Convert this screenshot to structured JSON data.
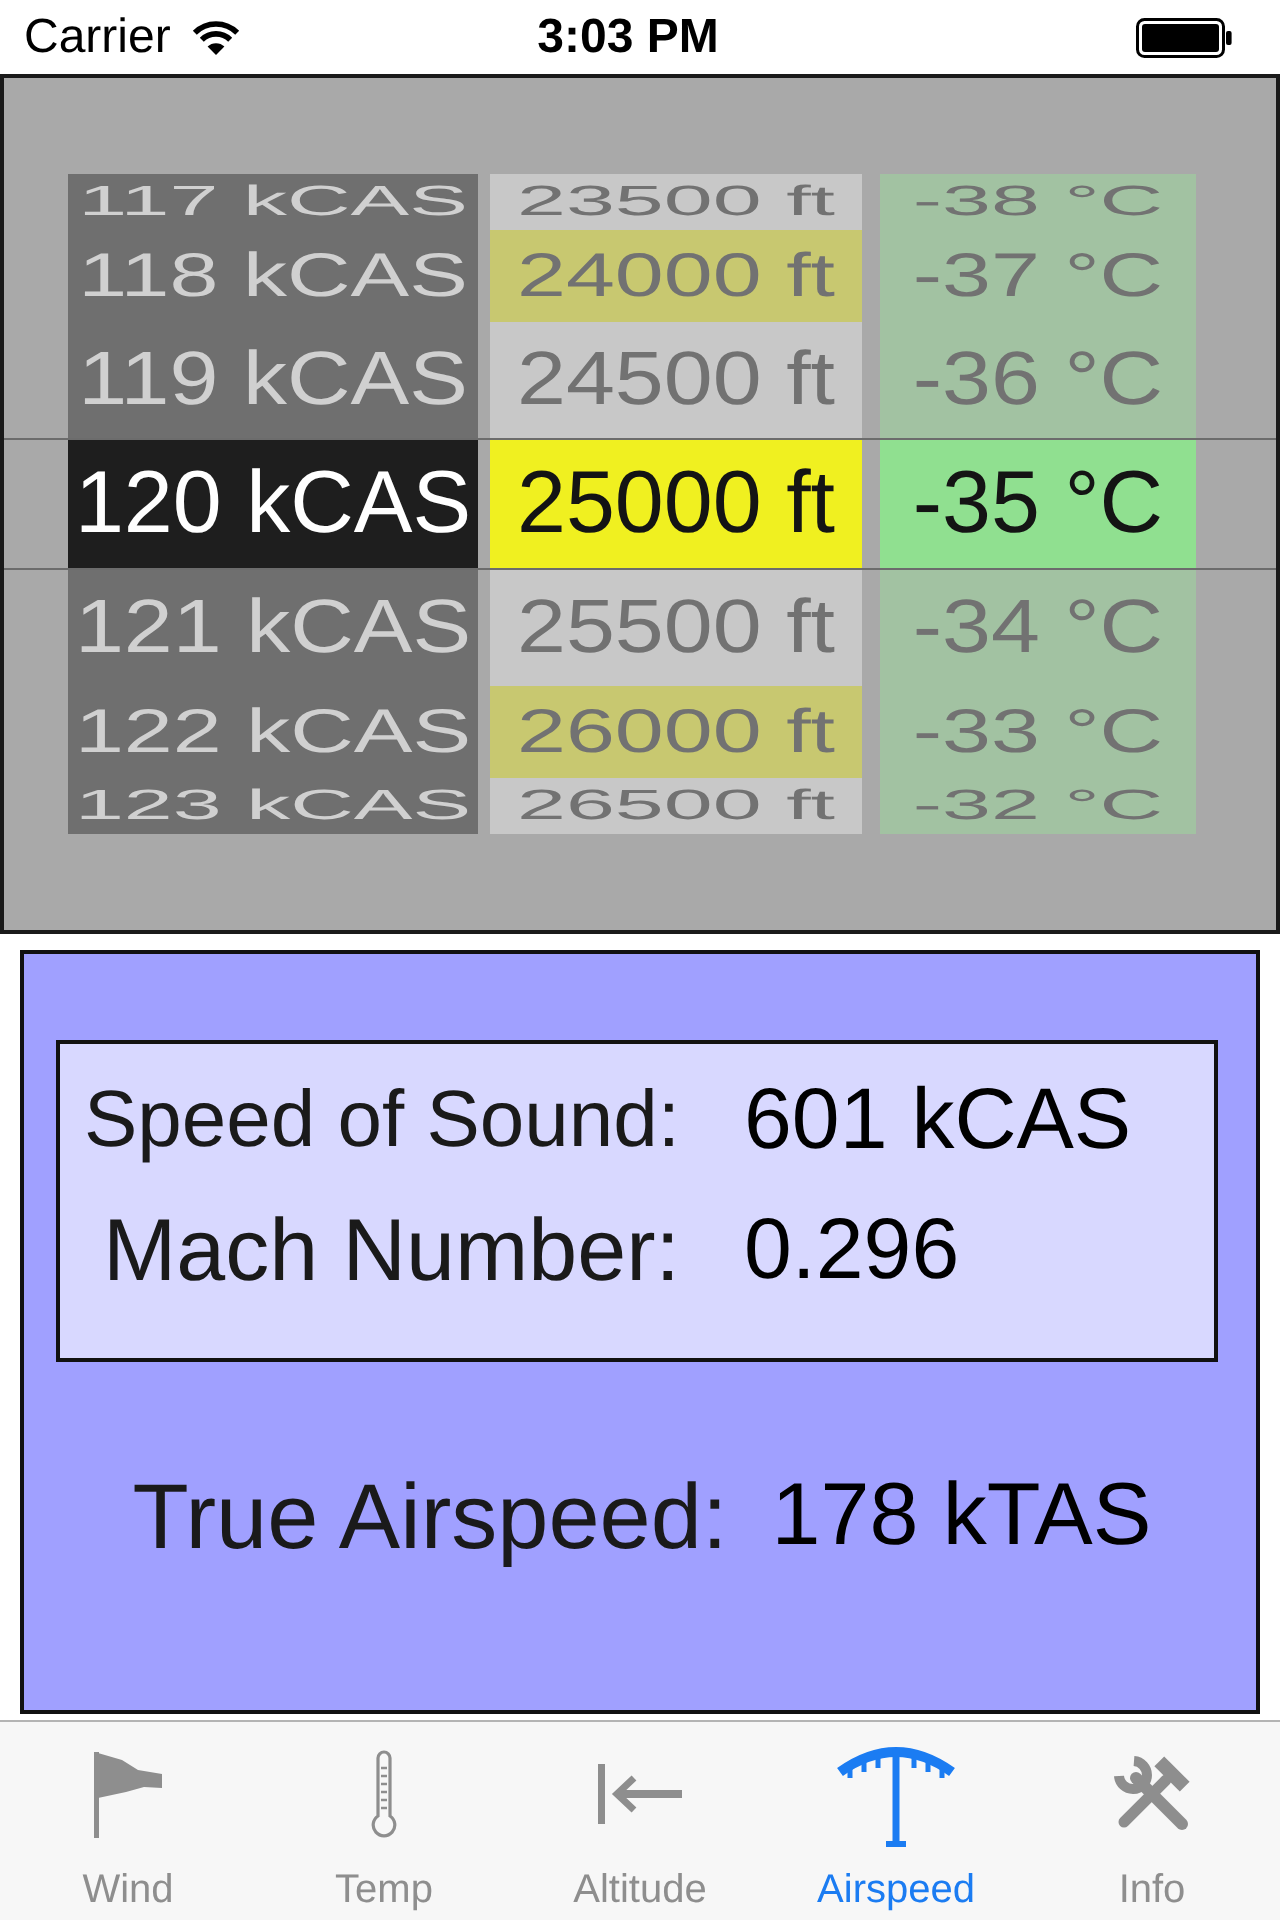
{
  "status_bar": {
    "carrier": "Carrier",
    "time": "3:03 PM"
  },
  "picker": {
    "columns": [
      {
        "items": [
          {
            "label": "117 kCAS",
            "selected": false,
            "color": "#6f6f6f"
          },
          {
            "label": "118 kCAS",
            "selected": false,
            "color": "#6f6f6f"
          },
          {
            "label": "119 kCAS",
            "selected": false,
            "color": "#6f6f6f"
          },
          {
            "label": "120 kCAS",
            "selected": true,
            "color": "#1e1e1e"
          },
          {
            "label": "121 kCAS",
            "selected": false,
            "color": "#6f6f6f"
          },
          {
            "label": "122 kCAS",
            "selected": false,
            "color": "#6f6f6f"
          },
          {
            "label": "123 kCAS",
            "selected": false,
            "color": "#6f6f6f"
          }
        ]
      },
      {
        "items": [
          {
            "label": "23500 ft",
            "selected": false,
            "color": "#c8c8c8"
          },
          {
            "label": "24000 ft",
            "selected": false,
            "color": "#c8c870"
          },
          {
            "label": "24500 ft",
            "selected": false,
            "color": "#c8c8c8"
          },
          {
            "label": "25000 ft",
            "selected": true,
            "color": "#f0f020"
          },
          {
            "label": "25500 ft",
            "selected": false,
            "color": "#c8c8c8"
          },
          {
            "label": "26000 ft",
            "selected": false,
            "color": "#c8c870"
          },
          {
            "label": "26500 ft",
            "selected": false,
            "color": "#c8c8c8"
          }
        ]
      },
      {
        "items": [
          {
            "label": "-38 °C",
            "selected": false,
            "color": "#a2c2a2"
          },
          {
            "label": "-37 °C",
            "selected": false,
            "color": "#a2c2a2"
          },
          {
            "label": "-36 °C",
            "selected": false,
            "color": "#a2c2a2"
          },
          {
            "label": "-35 °C",
            "selected": true,
            "color": "#90e090"
          },
          {
            "label": "-34 °C",
            "selected": false,
            "color": "#a2c2a2"
          },
          {
            "label": "-33 °C",
            "selected": false,
            "color": "#a2c2a2"
          },
          {
            "label": "-32 °C",
            "selected": false,
            "color": "#a2c2a2"
          }
        ]
      }
    ]
  },
  "results": {
    "readouts": [
      {
        "label": "Speed of Sound:",
        "value": "601 kCAS"
      },
      {
        "label": "Mach Number:",
        "value": "0.296"
      }
    ],
    "true_airspeed": {
      "label": "True Airspeed:",
      "value": "178 kTAS"
    }
  },
  "tab_bar": {
    "tabs": [
      {
        "label": "Wind",
        "selected": false
      },
      {
        "label": "Temp",
        "selected": false
      },
      {
        "label": "Altitude",
        "selected": false
      },
      {
        "label": "Airspeed",
        "selected": true
      },
      {
        "label": "Info",
        "selected": false
      }
    ]
  }
}
